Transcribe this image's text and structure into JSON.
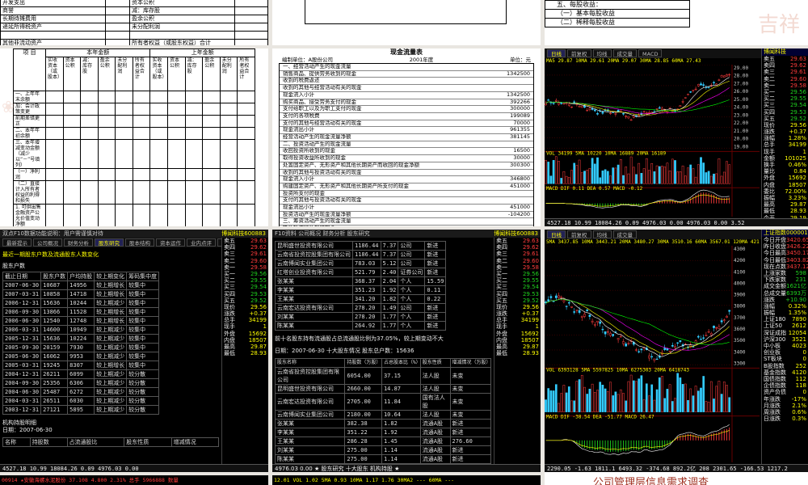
{
  "top_left_doc": {
    "rows": [
      [
        "开发支出",
        "资本公积"
      ],
      [
        "商誉",
        "减：库存股"
      ],
      [
        "长期待摊费用",
        "盈余公积"
      ],
      [
        "递延所得税资产",
        "未分配利润"
      ],
      [
        "",
        ""
      ],
      [
        "其他非流动资产",
        "所有者权益（或股东权益）合计"
      ],
      [
        "非流动资产合计",
        ""
      ]
    ]
  },
  "top_right_doc": {
    "line1": "五、每股收益：",
    "line2": "（一）基本每股收益",
    "line3": "（二）稀释每股收益"
  },
  "equity_doc": {
    "col_project": "项 目",
    "group_current": "本年金额",
    "group_prior": "上年金额",
    "sub_headers": [
      "实收资本（或股本）",
      "资本公积",
      "减：库存股",
      "盈余公积",
      "未分配利润",
      "所有者权益合计"
    ],
    "rows": [
      "一、上年年末余额",
      "加：会计政策变更",
      "前期差错更正",
      "二、本年年初余额",
      "三、本年增减变动金额（减少以“－”号填列）",
      "（一）净利润",
      "（二）直接计入所有者权益的利得和损失",
      "1. 可供出售金融资产公允价值变动净额",
      "2. 权益法下被投资单位其他所有者权益变动的影响",
      "3. 与计入所有者权益项目相关的所得税影响",
      "4. 其他",
      "上述（一）和（二）小计",
      "（三）所有者投入和减少资本"
    ]
  },
  "cashflow_doc": {
    "title": "现金流量表",
    "company": "编制单位：A股份公司",
    "year": "2001年度",
    "unit": "单位：元",
    "rows": [
      [
        "一、经营活动产生的现金流量",
        ""
      ],
      [
        "销售商品、提供劳务收到的现金",
        "1342500"
      ],
      [
        "收到的税费返还",
        ""
      ],
      [
        "收到的其他与经营活动有关的现金",
        ""
      ],
      [
        "现金流入小计",
        "1342500"
      ],
      [
        "购买商品、接受劳务支付的现金",
        "392266"
      ],
      [
        "支付给职工以及为职工支付的现金",
        "300000"
      ],
      [
        "支付的各项税费",
        "199089"
      ],
      [
        "支付的其他与经营活动有关的现金",
        "70000"
      ],
      [
        "现金流出小计",
        "961355"
      ],
      [
        "经营活动产生的现金流量净额",
        "381145"
      ],
      [
        "二、投资活动产生的现金流量",
        ""
      ],
      [
        "收回投资所收到的现金",
        "16500"
      ],
      [
        "取得投资收益所收到的现金",
        "30000"
      ],
      [
        "处置固定资产、无形资产和其他长期资产而收回的现金净额",
        "300300"
      ],
      [
        "收到的其他与投资活动有关的现金",
        ""
      ],
      [
        "现金流入小计",
        "346800"
      ],
      [
        "购建固定资产、无形资产和其他长期资产所支付的现金",
        "451000"
      ],
      [
        "投资所支付的现金",
        ""
      ],
      [
        "支付的其他与投资活动有关的现金",
        ""
      ],
      [
        "现金流出小计",
        "451000"
      ],
      [
        "投资活动产生的现金流量净额",
        "-104200"
      ],
      [
        "三、筹资活动产生的现金流量",
        ""
      ],
      [
        "吸收投资所收到的现金",
        ""
      ],
      [
        "借款所收到的现金",
        "400000"
      ],
      [
        "收到的其他与筹资活动有关的现金",
        ""
      ],
      [
        "现金流入小计",
        "400000"
      ],
      [
        "偿还债务所支付的现金",
        "1250000"
      ],
      [
        "分配股利、利润或偿付利息所支付的现金",
        "12500"
      ],
      [
        "支付的其他与筹资活动有关的现金",
        ""
      ],
      [
        "现金流出小计",
        "1262500"
      ],
      [
        "筹资活动产生的现金流量净额",
        "-862500"
      ],
      [
        "四、汇率变动对现金的影响",
        ""
      ],
      [
        "五、现金及现金等价物净增加额",
        "-585555"
      ]
    ]
  },
  "chart1": {
    "tabs": [
      "日线",
      "前复权",
      "均线",
      "成交量",
      "MACD"
    ],
    "ma_line": "MA5 29.87  10MA 29.61  20MA 29.07  30MA 28.85  60MA 27.43",
    "high": "29.87",
    "low": "27.20",
    "vol_line": "VOL 34199  5MA 10220  10MA 16889  20MA 16189",
    "macd_line": "MACD  DIF 0.11  DEA 0.57  MACD -0.12",
    "y_labels": [
      "29.00",
      "28.00",
      "27.00",
      "26.00",
      "25.00",
      "24.00",
      "23.00",
      "22.00",
      "21.00",
      "20.00",
      "19.00"
    ],
    "side_title": "博闻科技",
    "side_rows": [
      [
        "卖五",
        "29.63"
      ],
      [
        "卖四",
        "29.62"
      ],
      [
        "卖三",
        "29.61"
      ],
      [
        "卖二",
        "29.60"
      ],
      [
        "卖一",
        "29.58"
      ],
      [
        "买一",
        "29.56"
      ],
      [
        "买二",
        "29.55"
      ],
      [
        "买三",
        "29.54"
      ],
      [
        "买四",
        "29.53"
      ],
      [
        "买五",
        "29.52"
      ],
      [
        "现价",
        "29.56"
      ],
      [
        "涨跌",
        "+0.37"
      ],
      [
        "涨幅",
        "1.28%"
      ],
      [
        "总手",
        "34199"
      ],
      [
        "现手",
        "1"
      ],
      [
        "金额",
        "101025"
      ],
      [
        "换手",
        "0.46%"
      ],
      [
        "量比",
        "0.84"
      ],
      [
        "外盘",
        "15692"
      ],
      [
        "内盘",
        "18507"
      ],
      [
        "委比",
        "72.00%"
      ],
      [
        "振幅",
        "3.23%"
      ],
      [
        "最高",
        "29.87"
      ],
      [
        "最低",
        "28.93"
      ],
      [
        "今开",
        "29.19"
      ],
      [
        "昨收",
        "29.19"
      ],
      [
        "均价",
        "29.39"
      ],
      [
        "市盈",
        "63.26"
      ]
    ],
    "bottom_text": "4527.18 10.99  18084.26 0.09  4976.03 0.00  4976.03 0.00  3.52"
  },
  "shareholder_term": {
    "top_text": "双点F10数据功能说明：用户需谨慎对待",
    "banner_title": "博闻科技600883",
    "tabs": [
      "最新提示",
      "公司概况",
      "财务分析",
      "股东研究",
      "股本结构",
      "资本运作",
      "业内点评",
      "行业分析"
    ],
    "intro": "最近一期股东户数及流通股东人数变化",
    "section": "股东户数",
    "col_headers": [
      "截止日期",
      "股东户数",
      "户均持股",
      "较上期变化",
      "筹码集中度"
    ],
    "rows": [
      [
        "2007-06-30",
        "10687",
        "14956",
        "较上期增长",
        "较集中"
      ],
      [
        "2007-03-31",
        "10858",
        "14718",
        "较上期增长",
        "较集中"
      ],
      [
        "2006-12-31",
        "15636",
        "10244",
        "较上期减少",
        "较集中"
      ],
      [
        "2006-09-30",
        "13866",
        "11528",
        "较上期增长",
        "较集中"
      ],
      [
        "2006-06-30",
        "12540",
        "12748",
        "较上期增长",
        "较集中"
      ],
      [
        "2006-03-31",
        "14600",
        "10949",
        "较上期减少",
        "较集中"
      ],
      [
        "2005-12-31",
        "15636",
        "10224",
        "较上期减少",
        "较集中"
      ],
      [
        "2005-09-30",
        "20159",
        "7930",
        "较上期减少",
        "较集中"
      ],
      [
        "2005-06-30",
        "16062",
        "9953",
        "较上期减少",
        "较集中"
      ],
      [
        "2005-03-31",
        "19245",
        "8307",
        "较上期增长",
        "较集中"
      ],
      [
        "2004-12-31",
        "26211",
        "6099",
        "较上期减少",
        "较分散"
      ],
      [
        "2004-09-30",
        "25356",
        "6306",
        "较上期减少",
        "较分散"
      ],
      [
        "2004-06-30",
        "25487",
        "6272",
        "较上期减少",
        "较分散"
      ],
      [
        "2004-03-31",
        "26511",
        "6030",
        "较上期减少",
        "较分散"
      ],
      [
        "2003-12-31",
        "27121",
        "5895",
        "较上期减少",
        "较分散"
      ]
    ],
    "org_section": "机构持股明细",
    "org_date": "日期：2007-06-30",
    "org_headers": [
      "名称",
      "持股数",
      "占流通股比",
      "股东性质",
      "增减情况"
    ],
    "right_rows": [
      [
        "卖五",
        "29.63"
      ],
      [
        "卖四",
        "29.62"
      ],
      [
        "卖三",
        "29.61"
      ],
      [
        "卖二",
        "29.60"
      ],
      [
        "卖一",
        "29.58"
      ],
      [
        "买一",
        "29.56"
      ],
      [
        "买二",
        "29.55"
      ],
      [
        "买三",
        "29.54"
      ],
      [
        "买四",
        "29.53"
      ],
      [
        "买五",
        "29.52"
      ],
      [
        "现价",
        "29.56"
      ],
      [
        "涨跌",
        "+0.37"
      ],
      [
        "总手",
        "34199"
      ],
      [
        "现手",
        "1"
      ],
      [
        "外盘",
        "15692"
      ],
      [
        "内盘",
        "18507"
      ],
      [
        "最高",
        "29.87"
      ],
      [
        "最低",
        "28.93"
      ]
    ],
    "bottom_text": "4527.18 10.99  18084.26 0.09  4976.03 0.00"
  },
  "top10_term": {
    "top_text": "F10资料  公司概况  财务分析  股东研究",
    "banner_title": "博闻科技600883",
    "rows": [
      [
        "昆明盛世投资有限公司",
        "1186.44",
        "7.37",
        "公司",
        "新进"
      ],
      [
        "云南省投资控股集团有限公司",
        "1186.44",
        "7.37",
        "公司",
        "新进"
      ],
      [
        "云南博闻实业集团公司",
        "783.03",
        "5.12",
        "公司",
        "新进"
      ],
      [
        "红塔创业投资有限公司",
        "521.79",
        "2.40",
        "证券公司",
        "新进"
      ],
      [
        "张某某",
        "368.37",
        "2.04",
        "个人",
        "15.59"
      ],
      [
        "李某某",
        "351.23",
        "1.92",
        "个人",
        "0.11"
      ],
      [
        "王某某",
        "341.20",
        "1.82",
        "个人",
        "0.22"
      ],
      [
        "云南宏达投资有限公司",
        "278.20",
        "1.49",
        "公司",
        "新进"
      ],
      [
        "刘某某",
        "278.20",
        "1.77",
        "个人",
        "新进"
      ],
      [
        "陈某某",
        "264.92",
        "1.77",
        "个人",
        "新进"
      ]
    ],
    "summary": "前十名股东持有流通股占总流通股比例为37.05%，较上期变动不大",
    "date_line": "日期：2007-06-30  十大股东情况    股东总户数：15636",
    "headers2": [
      "股东名称",
      "持股数（万股）",
      "占总股本比（%）",
      "股东性质",
      "增减情况（万股）"
    ],
    "rows2": [
      [
        "云南省投资控股集团有限公司",
        "6054.00",
        "37.15",
        "法人股",
        "未变"
      ],
      [
        "昆明盛世投资有限公司",
        "2660.00",
        "14.87",
        "法人股",
        "未变"
      ],
      [
        "云南宏达投资有限公司",
        "2705.00",
        "11.84",
        "国有法人股",
        "未变"
      ],
      [
        "云南博闻实业集团公司",
        "2180.00",
        "10.64",
        "法人股",
        "未变"
      ],
      [
        "张某某",
        "382.38",
        "1.82",
        "流通A股",
        "新进"
      ],
      [
        "李某某",
        "351.22",
        "1.92",
        "流通A股",
        "新进"
      ],
      [
        "王某某",
        "286.28",
        "1.45",
        "流通A股",
        "276.60"
      ],
      [
        "刘某某",
        "275.00",
        "1.14",
        "流通A股",
        "新进"
      ],
      [
        "陈某某",
        "275.00",
        "1.14",
        "流通A股",
        "新进"
      ]
    ],
    "right_rows": [
      [
        "卖五",
        "29.63"
      ],
      [
        "卖四",
        "29.62"
      ],
      [
        "卖三",
        "29.61"
      ],
      [
        "卖二",
        "29.60"
      ],
      [
        "卖一",
        "29.58"
      ],
      [
        "买一",
        "29.56"
      ],
      [
        "买二",
        "29.55"
      ],
      [
        "买三",
        "29.54"
      ],
      [
        "买四",
        "29.53"
      ],
      [
        "买五",
        "29.52"
      ],
      [
        "现价",
        "29.56"
      ],
      [
        "涨跌",
        "+0.37"
      ],
      [
        "总手",
        "34199"
      ],
      [
        "现手",
        "1"
      ],
      [
        "外盘",
        "15692"
      ],
      [
        "内盘",
        "18507"
      ],
      [
        "最高",
        "29.87"
      ],
      [
        "最低",
        "28.93"
      ]
    ],
    "bottom_text": "4976.03 0.00  ★ 股东研究  十大股东  机构持股  ★"
  },
  "chart2": {
    "tabs": [
      "日线",
      "前复权",
      "均线",
      "成交量"
    ],
    "ma_line": "5MA 3437.85  10MA 3443.21  20MA 3480.27  30MA 3510.16  60MA 3567.01  120MA 4211.46",
    "vol_line": "VOL 6393128  5MA 5597825  10MA 6275303  20MA 6418743",
    "macd_line": "MACD  DIF -38.54  DEA -51.77  MACD 26.47",
    "title": "上证指数000001",
    "y_labels": [
      "4300",
      "4200",
      "4100",
      "4000",
      "3900",
      "3800",
      "3700",
      "3600",
      "3500",
      "3400",
      "3300"
    ],
    "side_rows": [
      [
        "今日开盘",
        "3420.65"
      ],
      [
        "昨日收盘",
        "3426.22"
      ],
      [
        "今日最高",
        "3450.17"
      ],
      [
        "今日最低",
        "3403.82"
      ],
      [
        "现在点数",
        "3437.12"
      ],
      [
        "上涨家数",
        "598"
      ],
      [
        "下跌家数",
        "231"
      ],
      [
        "成交金额",
        "1621亿"
      ],
      [
        "总成交量",
        "6393万"
      ],
      [
        "涨跌",
        "+10.90"
      ],
      [
        "涨幅",
        "0.32%"
      ],
      [
        "振幅",
        "1.35%"
      ],
      [
        "上证180",
        "7890"
      ],
      [
        "上证50",
        "2612"
      ],
      [
        "深证成指",
        "12054"
      ],
      [
        "沪深300",
        "3521"
      ],
      [
        "中小板",
        "4023"
      ],
      [
        "创业板",
        "0"
      ],
      [
        "ST板块",
        "0"
      ],
      [
        "B股指数",
        "252"
      ],
      [
        "基金指数",
        "4120"
      ],
      [
        "国债指数",
        "112"
      ],
      [
        "企债指数",
        "118"
      ],
      [
        "资产负债",
        "0"
      ],
      [
        "年涨跌",
        "-17%"
      ],
      [
        "月涨跌",
        "2.1%"
      ],
      [
        "周涨跌",
        "0.6%"
      ],
      [
        "日涨跌",
        "0.3%"
      ]
    ],
    "bottom_text": "2290.05  -1.63  1811.1    6493.32  -374.68  892.2亿  208  2301.65  -166.53  1217.2"
  },
  "bottom_doc": {
    "title": "公司管理层信息需求调查"
  },
  "bottom_terms": {
    "left_text": "00914 ★安徽海螺水泥股份  37.108  4.800  2.31%  总手 5966888  数量",
    "mid_text": "12.01  VOL 1.02   5MA 0.93  10MA 1.17  1.76  30MA2 ---  60MA ---",
    "right_text": "涨跌 6.00"
  },
  "deco_text": "吉祥"
}
